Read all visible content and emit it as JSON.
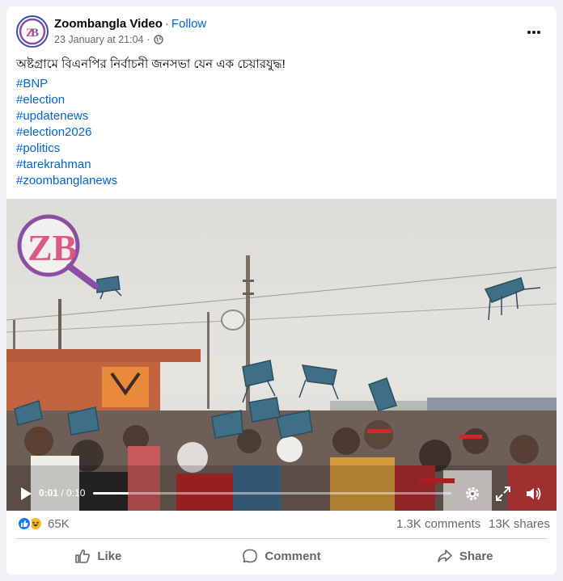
{
  "post": {
    "page_name": "Zoombangla Video",
    "separator": "·",
    "follow_label": "Follow",
    "timestamp": "23 January at 21:04",
    "meta_separator": "·",
    "caption": "অষ্টগ্রামে বিএনপির নির্বাচনী জনসভা যেন এক চেয়ারযুদ্ধ!",
    "hashtags": [
      "#BNP",
      "#election",
      "#updatenews",
      "#election2026",
      "#politics",
      "#tarekrahman",
      "#zoombanglanews"
    ],
    "avatar_icon": "zoombangla-logo-icon",
    "privacy_icon": "globe-icon"
  },
  "video": {
    "current_time": "0:01",
    "time_separator": " / ",
    "duration": "0:10",
    "progress_fraction": 0.1,
    "watermark": "ZB"
  },
  "stats": {
    "reaction_icons": [
      "like-icon",
      "haha-icon"
    ],
    "reaction_count": "65K",
    "comments": "1.3K comments",
    "shares": "13K shares"
  },
  "actions": {
    "like_label": "Like",
    "comment_label": "Comment",
    "share_label": "Share"
  },
  "colors": {
    "link": "#0064d1",
    "secondary_text": "#65676b",
    "like_blue": "#1877f2",
    "haha_yellow": "#f7b928",
    "brand_purple": "#8a4fa3",
    "brand_pink": "#d94a7a"
  }
}
